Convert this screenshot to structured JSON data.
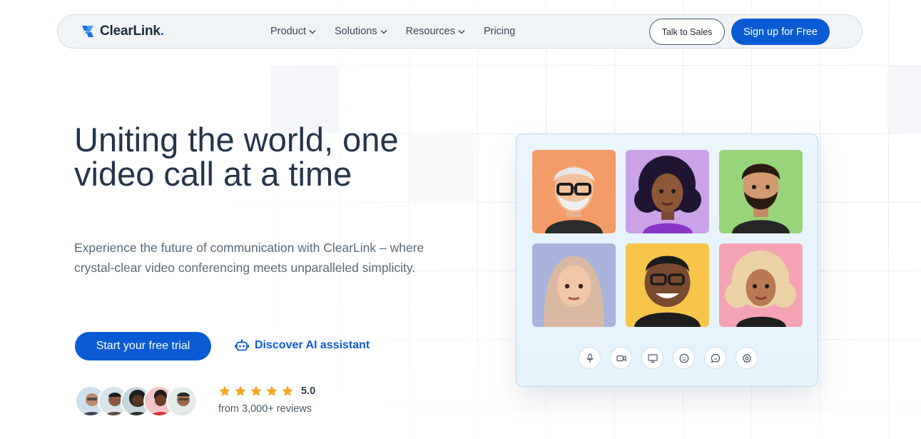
{
  "brand": {
    "name": "ClearLink",
    "dot": ".",
    "accent": "#0a5bd3"
  },
  "nav": {
    "items": [
      {
        "label": "Product",
        "has_dropdown": true
      },
      {
        "label": "Solutions",
        "has_dropdown": true
      },
      {
        "label": "Resources",
        "has_dropdown": true
      },
      {
        "label": "Pricing",
        "has_dropdown": false
      }
    ],
    "talk_to_sales": "Talk to Sales",
    "signup": "Sign up for Free"
  },
  "hero": {
    "title": "Uniting the world, one video call at a time",
    "subtitle": "Experience the future of communication with ClearLink – where crystal-clear video conferencing meets unparalleled simplicity.",
    "cta_primary": "Start your free trial",
    "cta_secondary": "Discover AI assistant",
    "cta_secondary_icon": "robot-icon"
  },
  "social_proof": {
    "avatars": [
      "reviewer-avatar-1",
      "reviewer-avatar-2",
      "reviewer-avatar-3",
      "reviewer-avatar-4",
      "reviewer-avatar-5"
    ],
    "stars": 5,
    "score": "5.0",
    "reviews_text": "from 3,000+ reviews",
    "star_color": "#f5a623"
  },
  "call_card": {
    "participants": [
      {
        "name": "participant-older-man",
        "bg": "#f49b6a"
      },
      {
        "name": "participant-curly-woman",
        "bg": "#c9a2e8"
      },
      {
        "name": "participant-bearded-man",
        "bg": "#98d47a"
      },
      {
        "name": "participant-hijab-woman",
        "bg": "#a9b3dc"
      },
      {
        "name": "participant-smiling-man",
        "bg": "#f6c54a"
      },
      {
        "name": "participant-blonde-woman",
        "bg": "#f4a3b4"
      }
    ],
    "controls": [
      "microphone-icon",
      "camera-icon",
      "screen-share-icon",
      "emoji-icon",
      "chat-icon",
      "settings-icon"
    ]
  }
}
